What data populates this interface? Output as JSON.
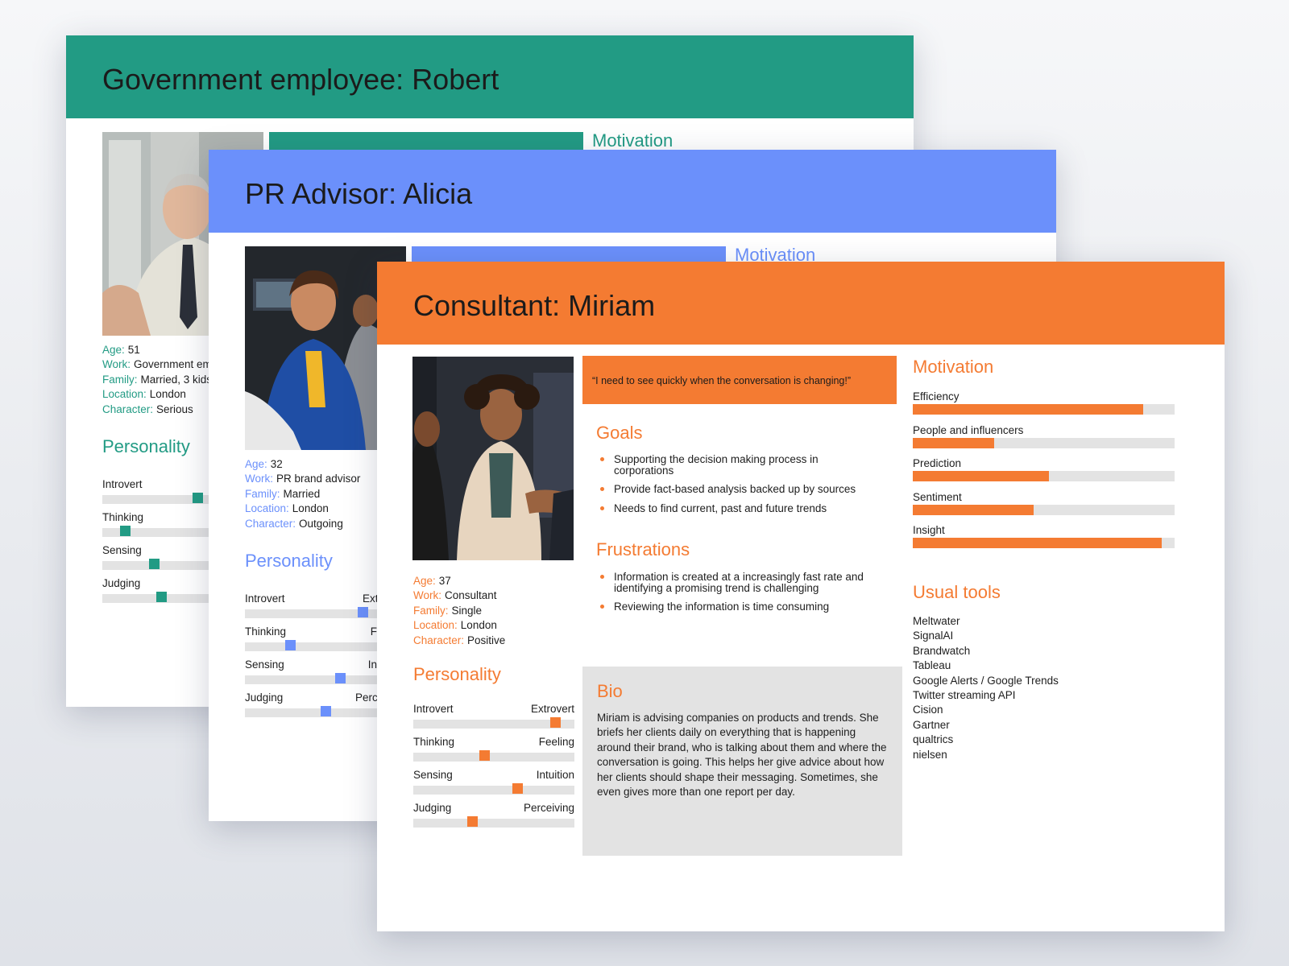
{
  "cards": {
    "robert": {
      "title": "Government employee: Robert",
      "color": "#229b84",
      "motivation_title": "Motivation",
      "info": {
        "age_label": "Age:",
        "age": "51",
        "work_label": "Work:",
        "work": "Government employee",
        "family_label": "Family:",
        "family": "Married, 3 kids",
        "location_label": "Location:",
        "location": "London",
        "character_label": "Character:",
        "character": "Serious"
      },
      "personality_title": "Personality",
      "traits": [
        {
          "left": "Introvert",
          "value": 0.6
        },
        {
          "left": "Thinking",
          "value": 0.12
        },
        {
          "left": "Sensing",
          "value": 0.31
        },
        {
          "left": "Judging",
          "value": 0.36
        }
      ]
    },
    "alicia": {
      "title": "PR Advisor: Alicia",
      "color": "#6b90fb",
      "motivation_title": "Motivation",
      "info": {
        "age_label": "Age:",
        "age": "32",
        "work_label": "Work:",
        "work": "PR brand advisor",
        "family_label": "Family:",
        "family": "Married",
        "location_label": "Location:",
        "location": "London",
        "character_label": "Character:",
        "character": "Outgoing"
      },
      "personality_title": "Personality",
      "traits": [
        {
          "left": "Introvert",
          "right": "Extrovert",
          "value": 0.75
        },
        {
          "left": "Thinking",
          "right": "Feeling",
          "value": 0.27
        },
        {
          "left": "Sensing",
          "right": "Intuition",
          "value": 0.6
        },
        {
          "left": "Judging",
          "right": "Perceiving",
          "value": 0.5
        }
      ]
    },
    "miriam": {
      "title": "Consultant: Miriam",
      "color": "#f47b32",
      "quote": "“I need to see quickly when the conversation is changing!”",
      "goals_title": "Goals",
      "goals": [
        "Supporting the decision making process in corporations",
        "Provide fact-based analysis backed up by sources",
        "Needs to find current, past and future trends"
      ],
      "frustrations_title": "Frustrations",
      "frustrations": [
        "Information is created at a increasingly fast rate and identifying a promising trend is challenging",
        "Reviewing the information is time consuming"
      ],
      "bio_title": "Bio",
      "bio": "Miriam is advising companies on products and trends. She briefs her clients daily on everything that is happening around their brand, who is talking about them and where the conversation is going. This helps her give advice about how her clients should shape their messaging. Sometimes, she even gives more than one report per day.",
      "info": {
        "age_label": "Age:",
        "age": "37",
        "work_label": "Work:",
        "work": "Consultant",
        "family_label": "Family:",
        "family": "Single",
        "location_label": "Location:",
        "location": "London",
        "character_label": "Character:",
        "character": "Positive"
      },
      "personality_title": "Personality",
      "traits": [
        {
          "left": "Introvert",
          "right": "Extrovert",
          "value": 0.91
        },
        {
          "left": "Thinking",
          "right": "Feeling",
          "value": 0.44
        },
        {
          "left": "Sensing",
          "right": "Intuition",
          "value": 0.66
        },
        {
          "left": "Judging",
          "right": "Perceiving",
          "value": 0.36
        }
      ],
      "motivation_title": "Motivation",
      "motivations": [
        {
          "label": "Efficiency",
          "value": 0.88
        },
        {
          "label": "People and influencers",
          "value": 0.31
        },
        {
          "label": "Prediction",
          "value": 0.52
        },
        {
          "label": "Sentiment",
          "value": 0.46
        },
        {
          "label": "Insight",
          "value": 0.95
        }
      ],
      "tools_title": "Usual tools",
      "tools": [
        "Meltwater",
        "SignalAI",
        "Brandwatch",
        "Tableau",
        "Google Alerts / Google Trends",
        "Twitter streaming API",
        "Cision",
        "Gartner",
        "qualtrics",
        "nielsen"
      ]
    }
  }
}
